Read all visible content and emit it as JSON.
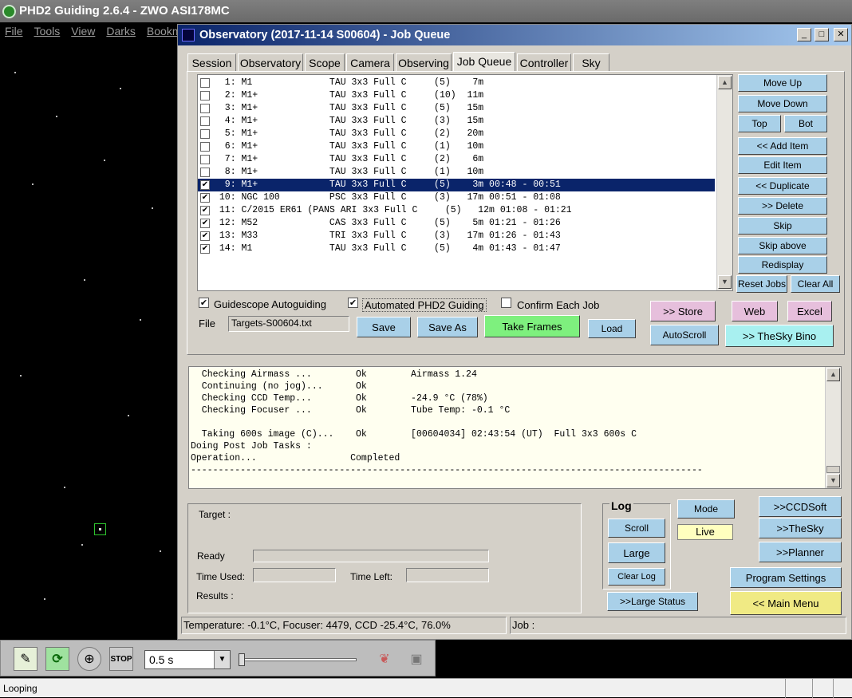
{
  "phd": {
    "title": "PHD2 Guiding 2.6.4 - ZWO ASI178MC",
    "menu": [
      "File",
      "Tools",
      "View",
      "Darks",
      "Bookm"
    ],
    "exposure": "0.5 s",
    "status": "Looping",
    "toolbar_icons": [
      "guide-pencil-icon",
      "loop-icon",
      "crosshair-icon",
      "stop-icon",
      "brain-icon",
      "camera-icon"
    ],
    "stop_label": "STOP"
  },
  "dialog": {
    "title": "Observatory (2017-11-14 S00604) - Job Queue",
    "window_buttons": {
      "minimize": "_",
      "maximize": "□",
      "close": "✕"
    },
    "tabs": [
      "Session",
      "Observatory",
      "Scope",
      "Camera",
      "Observing",
      "Job Queue",
      "Controller",
      "Sky"
    ],
    "active_tab": "Job Queue",
    "jobs": [
      {
        "checked": false,
        "text": "  1: M1              TAU 3x3 Full C     (5)    7m"
      },
      {
        "checked": false,
        "text": "  2: M1+             TAU 3x3 Full C     (10)  11m"
      },
      {
        "checked": false,
        "text": "  3: M1+             TAU 3x3 Full C     (5)   15m"
      },
      {
        "checked": false,
        "text": "  4: M1+             TAU 3x3 Full C     (3)   15m"
      },
      {
        "checked": false,
        "text": "  5: M1+             TAU 3x3 Full C     (2)   20m"
      },
      {
        "checked": false,
        "text": "  6: M1+             TAU 3x3 Full C     (1)   10m"
      },
      {
        "checked": false,
        "text": "  7: M1+             TAU 3x3 Full C     (2)    6m"
      },
      {
        "checked": false,
        "text": "  8: M1+             TAU 3x3 Full C     (1)   10m"
      },
      {
        "checked": true,
        "text": "  9: M1+             TAU 3x3 Full C     (5)    3m 00:48 - 00:51"
      },
      {
        "checked": true,
        "text": " 10: NGC 100         PSC 3x3 Full C     (3)   17m 00:51 - 01:08"
      },
      {
        "checked": true,
        "text": " 11: C/2015 ER61 (PANS ARI 3x3 Full C     (5)   12m 01:08 - 01:21"
      },
      {
        "checked": true,
        "text": " 12: M52             CAS 3x3 Full C     (5)    5m 01:21 - 01:26"
      },
      {
        "checked": true,
        "text": " 13: M33             TRI 3x3 Full C     (3)   17m 01:26 - 01:43"
      },
      {
        "checked": true,
        "text": " 14: M1              TAU 3x3 Full C     (5)    4m 01:43 - 01:47"
      }
    ],
    "selected_index": 8,
    "side_buttons": {
      "move_up": "Move Up",
      "move_down": "Move Down",
      "top": "Top",
      "bot": "Bot",
      "add_item": "<< Add Item",
      "edit_item": "Edit Item",
      "duplicate": "<< Duplicate",
      "delete": ">> Delete",
      "skip": "Skip",
      "skip_above": "Skip above",
      "redisplay": "Redisplay",
      "reset_jobs": "Reset Jobs",
      "clear_all": "Clear All"
    },
    "options": {
      "guidescope_autoguiding": {
        "label": "Guidescope Autoguiding",
        "checked": true
      },
      "automated_phd2": {
        "label": "Automated PHD2 Guiding",
        "checked": true
      },
      "confirm_each_job": {
        "label": "Confirm Each Job",
        "checked": false
      }
    },
    "file": {
      "label": "File",
      "value": "Targets-S00604.txt",
      "save": "Save",
      "save_as": "Save As",
      "take_frames": "Take Frames",
      "load": "Load"
    },
    "right_buttons": {
      "store": ">> Store",
      "web": "Web",
      "excel": "Excel",
      "autoscroll": "AutoScroll",
      "thesky_bino": ">> TheSky Bino"
    },
    "log_lines": [
      "  Checking Airmass ...        Ok        Airmass 1.24",
      "  Continuing (no jog)...      Ok",
      "  Checking CCD Temp...        Ok        -24.9 °C (78%)",
      "  Checking Focuser ...        Ok        Tube Temp: -0.1 °C",
      "",
      "  Taking 600s image (C)...    Ok        [00604034] 02:43:54 (UT)  Full 3x3 600s C",
      "Doing Post Job Tasks :",
      "Operation...                 Completed",
      "---------------------------------------------------------------------------------------------"
    ],
    "status_group": {
      "target": "Target :",
      "ready": "Ready",
      "time_used": "Time Used:",
      "time_left": "Time Left:",
      "results": "Results :"
    },
    "log_group": {
      "title": "Log",
      "scroll": "Scroll",
      "large": "Large",
      "clear_log": "Clear Log"
    },
    "mode": {
      "label": "Mode",
      "value": "Live"
    },
    "large_status": ">>Large Status",
    "nav_buttons": {
      "ccdsoft": ">>CCDSoft",
      "thesky": ">>TheSky",
      "planner": ">>Planner",
      "program_settings": "Program Settings",
      "main_menu": "<< Main Menu"
    },
    "statusbar": {
      "left": "Temperature: -0.1°C, Focuser: 4479, CCD -25.4°C, 76.0%",
      "right": "Job :"
    }
  }
}
